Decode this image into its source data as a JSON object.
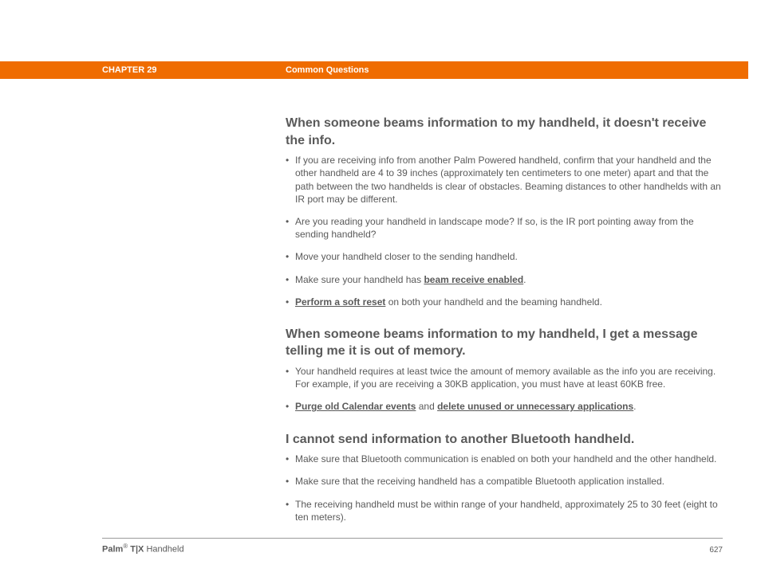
{
  "header": {
    "chapter": "CHAPTER 29",
    "section": "Common Questions"
  },
  "q1": {
    "heading": "When someone beams information to my handheld, it doesn't receive the info.",
    "b1": "If you are receiving info from another Palm Powered handheld, confirm that your handheld and the other handheld are 4 to 39 inches (approximately ten centimeters to one meter) apart and that the path between the two handhelds is clear of obstacles. Beaming distances to other handhelds with an IR port may be different.",
    "b2": "Are you reading your handheld in landscape mode? If so, is the IR port pointing away from the sending handheld?",
    "b3": "Move your handheld closer to the sending handheld.",
    "b4_pre": "Make sure your handheld has ",
    "b4_link": "beam receive enabled",
    "b4_post": ".",
    "b5_link": "Perform a soft reset",
    "b5_post": " on both your handheld and the beaming handheld."
  },
  "q2": {
    "heading": "When someone beams information to my handheld, I get a message telling me it is out of memory.",
    "b1": "Your handheld requires at least twice the amount of memory available as the info you are receiving. For example, if you are receiving a 30KB application, you must have at least 60KB free.",
    "b2_link1": "Purge old Calendar events",
    "b2_mid": " and ",
    "b2_link2": "delete unused or unnecessary applications",
    "b2_post": "."
  },
  "q3": {
    "heading": "I cannot send information to another Bluetooth handheld.",
    "b1": "Make sure that Bluetooth communication is enabled on both your handheld and the other handheld.",
    "b2": "Make sure that the receiving handheld has a compatible Bluetooth application installed.",
    "b3": "The receiving handheld must be within range of your handheld, approximately 25 to 30 feet (eight to ten meters)."
  },
  "footer": {
    "brand": "Palm",
    "reg": "®",
    "model": " T|X",
    "suffix": " Handheld",
    "page": "627"
  }
}
